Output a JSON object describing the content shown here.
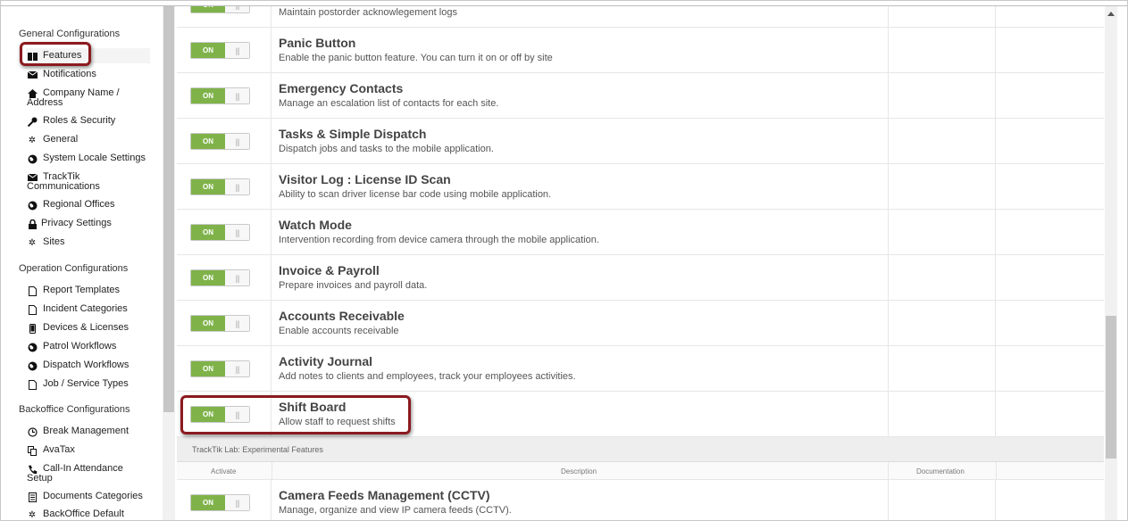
{
  "sidebar": {
    "sections": [
      {
        "title": "General Configurations",
        "items": [
          {
            "label": "Features",
            "icon": "gift-icon"
          },
          {
            "label": "Notifications",
            "icon": "envelope-icon"
          },
          {
            "label": "Company Name /",
            "label2": "Address",
            "icon": "home-icon"
          },
          {
            "label": "Roles & Security",
            "icon": "key-icon"
          },
          {
            "label": "General",
            "icon": "gear-icon"
          },
          {
            "label": "System Locale Settings",
            "icon": "globe-icon"
          },
          {
            "label": "TrackTik",
            "label2": "Communications",
            "icon": "envelope-icon"
          },
          {
            "label": "Regional Offices",
            "icon": "globe-icon"
          },
          {
            "label": "Privacy Settings",
            "icon": "lock-icon"
          },
          {
            "label": "Sites",
            "icon": "gear-icon"
          }
        ]
      },
      {
        "title": "Operation Configurations",
        "items": [
          {
            "label": "Report Templates",
            "icon": "document-icon"
          },
          {
            "label": "Incident Categories",
            "icon": "document-icon"
          },
          {
            "label": "Devices & Licenses",
            "icon": "mobile-icon"
          },
          {
            "label": "Patrol Workflows",
            "icon": "globe-icon"
          },
          {
            "label": "Dispatch Workflows",
            "icon": "globe-icon"
          },
          {
            "label": "Job / Service Types",
            "icon": "document-icon"
          }
        ]
      },
      {
        "title": "Backoffice Configurations",
        "items": [
          {
            "label": "Break Management",
            "icon": "clock-icon"
          },
          {
            "label": "AvaTax",
            "icon": "copy-icon"
          },
          {
            "label": "Call-In Attendance",
            "label2": "Setup",
            "icon": "phone-icon"
          },
          {
            "label": "Documents Categories",
            "icon": "list-icon"
          },
          {
            "label": "BackOffice Default",
            "icon": "gear-icon"
          }
        ]
      }
    ]
  },
  "toggle_label": "ON",
  "features": [
    {
      "title": "",
      "desc": "Maintain postorder acknowlegement logs"
    },
    {
      "title": "Panic Button",
      "desc": "Enable the panic button feature. You can turn it on or off by site"
    },
    {
      "title": "Emergency Contacts",
      "desc": "Manage an escalation list of contacts for each site."
    },
    {
      "title": "Tasks & Simple Dispatch",
      "desc": "Dispatch jobs and tasks to the mobile application."
    },
    {
      "title": "Visitor Log : License ID Scan",
      "desc": "Ability to scan driver license bar code using mobile application."
    },
    {
      "title": "Watch Mode",
      "desc": "Intervention recording from device camera through the mobile application."
    },
    {
      "title": "Invoice & Payroll",
      "desc": "Prepare invoices and payroll data."
    },
    {
      "title": "Accounts Receivable",
      "desc": "Enable accounts receivable"
    },
    {
      "title": "Activity Journal",
      "desc": "Add notes to clients and employees, track your employees activities."
    },
    {
      "title": "Shift Board",
      "desc": "Allow staff to request shifts"
    }
  ],
  "lab": {
    "header": "TrackTik Lab: Experimental Features",
    "col_activate": "Activate",
    "col_description": "Description",
    "col_documentation": "Documentation",
    "features": [
      {
        "title": "Camera Feeds Management (CCTV)",
        "desc": "Manage, organize and view IP camera feeds (CCTV)."
      }
    ]
  },
  "colors": {
    "toggle_on": "#7fb34a",
    "highlight": "#8b1a1f"
  }
}
